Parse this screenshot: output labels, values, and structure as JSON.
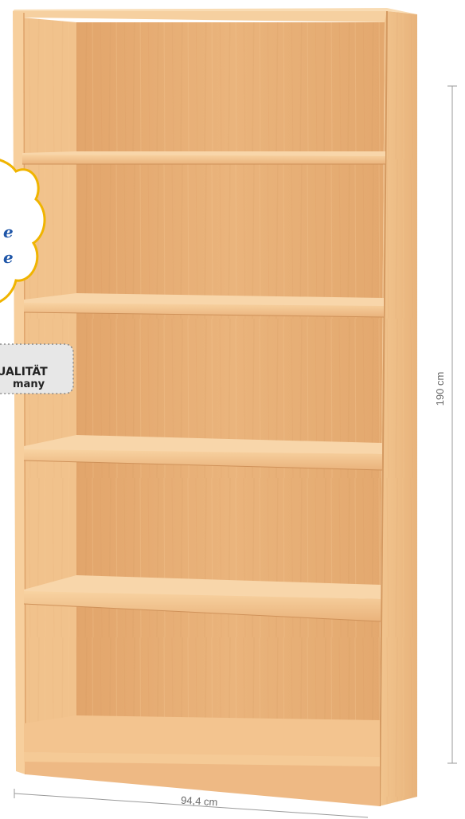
{
  "product": {
    "height_dimension": "190 cm",
    "width_dimension": "94,4 cm",
    "shelves_visible": 5
  },
  "quality_label": {
    "line1": "UALITÄT",
    "line2": "many"
  },
  "badge": {
    "line1": "e",
    "line2": "e"
  },
  "colors": {
    "wood_light": "#f3c792",
    "wood_mid": "#eab27a",
    "wood_dark": "#d99c62",
    "badge_border": "#f0b400",
    "badge_text": "#1f56a8",
    "label_bg": "#e7e7e7"
  }
}
